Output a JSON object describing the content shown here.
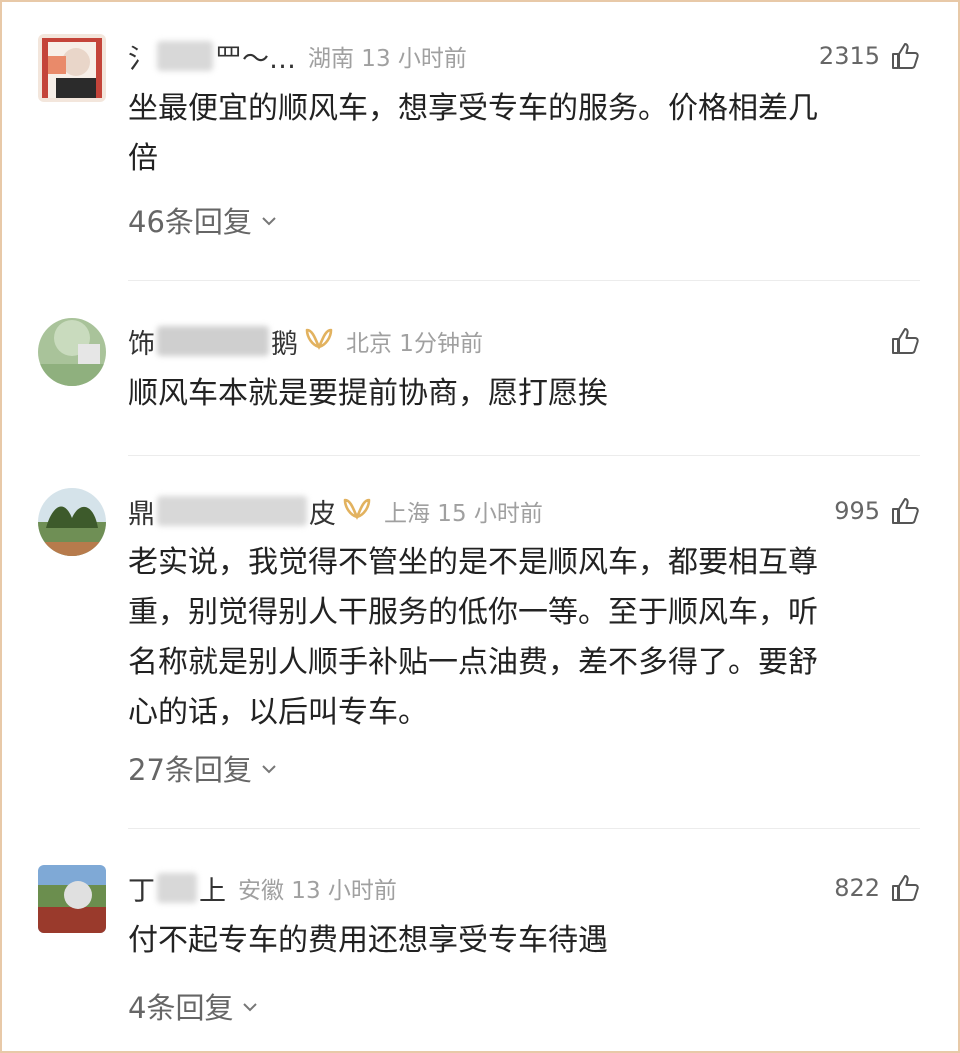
{
  "comments": [
    {
      "user": "氵",
      "user_tail": "罒～…",
      "location": "湖南 13 小时前",
      "likes": "2315",
      "text_lines": [
        "坐最便宜的顺风车，想享受专车的服务。价格相差几",
        "倍"
      ],
      "replies": "46条回复",
      "vip": false
    },
    {
      "user": "饰",
      "user_tail": "鹅",
      "location": "北京 1分钟前",
      "likes": "",
      "text_lines": [
        "顺风车本就是要提前协商，愿打愿挨"
      ],
      "replies": "",
      "vip": true
    },
    {
      "user": "鼎",
      "user_tail": "皮",
      "location": "上海 15 小时前",
      "likes": "995",
      "text_lines": [
        "老实说，我觉得不管坐的是不是顺风车，都要相互尊",
        "重，别觉得别人干服务的低你一等。至于顺风车，听",
        "名称就是别人顺手补贴一点油费，差不多得了。要舒",
        "心的话，以后叫专车。"
      ],
      "replies": "27条回复",
      "vip": true
    },
    {
      "user": "丁",
      "user_tail": "上",
      "location": "安徽 13 小时前",
      "likes": "822",
      "text_lines": [
        "付不起专车的费用还想享受专车待遇"
      ],
      "replies": "4条回复",
      "vip": false
    }
  ],
  "icons": {
    "like": "thumbs-up-icon",
    "vip": "vip-badge-icon",
    "expand": "chevron-down-icon"
  },
  "colors": {
    "frame": "#e8c9a8",
    "vip_gold": "#e2b25f",
    "meta_gray": "#a0a0a0"
  }
}
